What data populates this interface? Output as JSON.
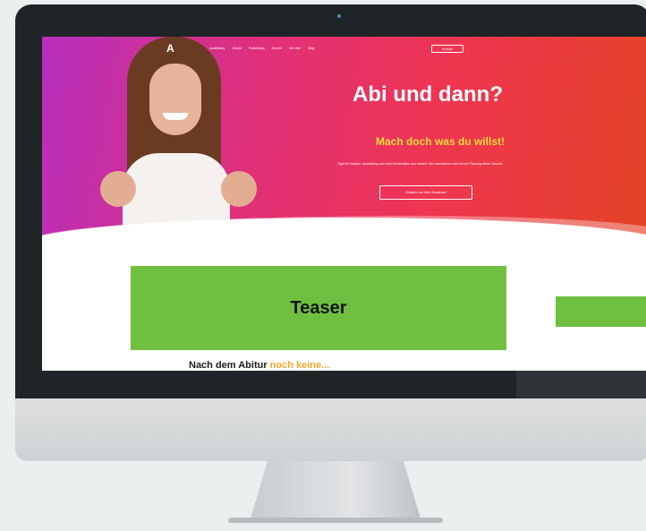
{
  "site": {
    "logo": "A",
    "nav": [
      "Ausbildung",
      "Schule",
      "Fortbildung",
      "Service",
      "Wir über",
      "Blog"
    ],
    "nav_cta": "Kontakt"
  },
  "hero": {
    "title": "Abi und dann?",
    "subtitle": "Mach doch was du willst!",
    "body": "Egal ob Studium, Ausbildung oder eine Kombination aus beidem. Wir unterstützen dich bei der Planung deiner Zukunft.",
    "button": "Studiere nun beim Studienort"
  },
  "content": {
    "heading_prefix": "Nach dem Abitur",
    "heading_accent": "noch keine..."
  },
  "overlay": {
    "teaser_label": "Teaser"
  },
  "colors": {
    "teaser_green": "#6fc040",
    "accent_yellow": "#f6dd3c",
    "accent_orange": "#f2a72c",
    "bezel": "#1f2427"
  }
}
